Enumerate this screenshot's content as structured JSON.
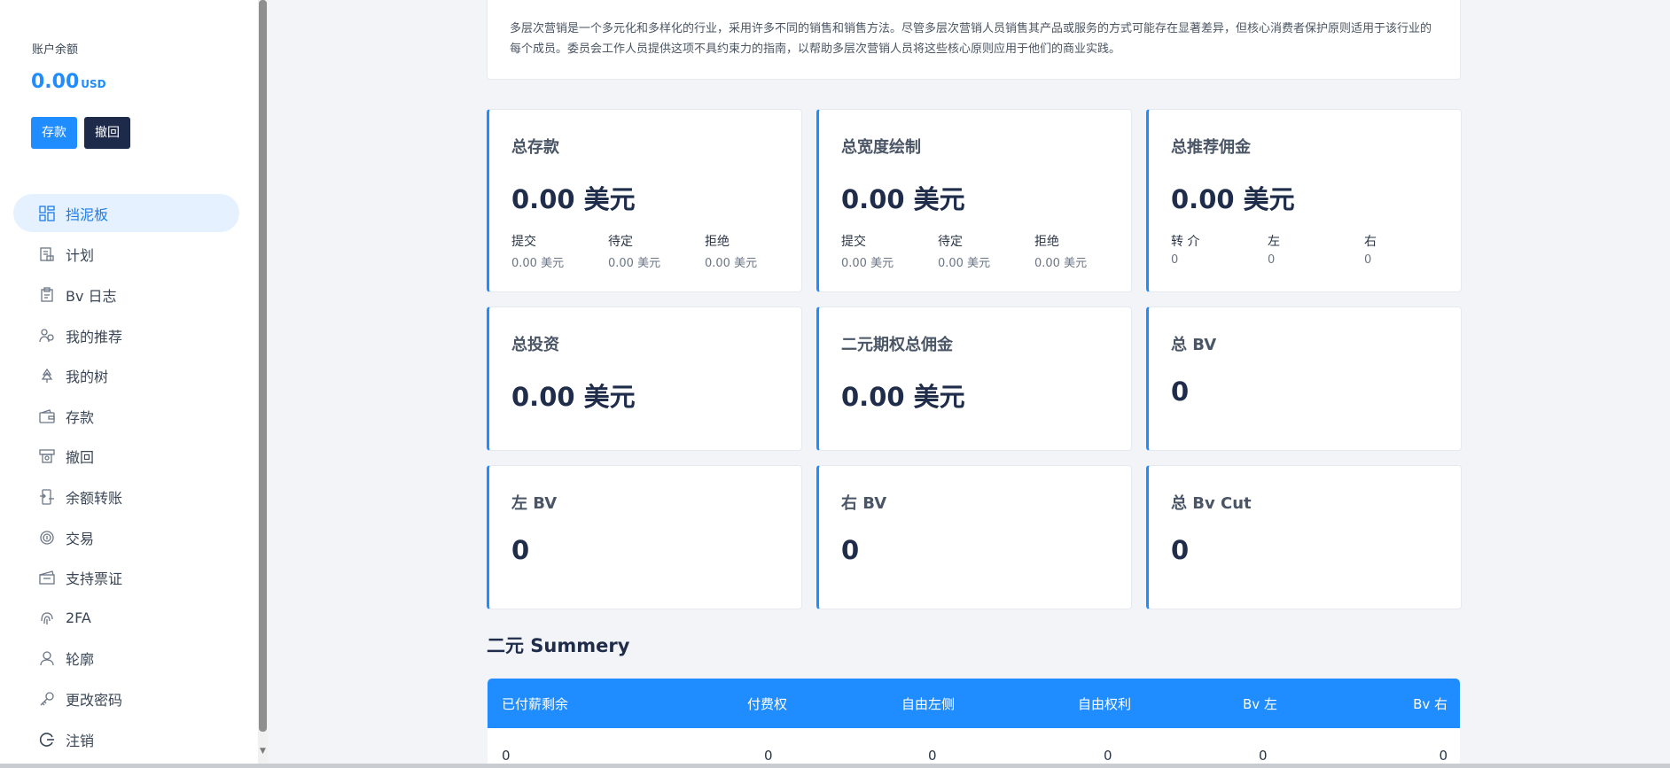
{
  "sidebar": {
    "balance_label": "账户余额",
    "balance_value": "0.00",
    "balance_currency": "USD",
    "deposit_button": "存款",
    "withdraw_button": "撤回",
    "items": [
      {
        "label": "挡泥板",
        "icon": "dashboard-icon",
        "active": true
      },
      {
        "label": "计划",
        "icon": "plan-icon"
      },
      {
        "label": "Bv 日志",
        "icon": "log-icon"
      },
      {
        "label": "我的推荐",
        "icon": "referral-icon"
      },
      {
        "label": "我的树",
        "icon": "tree-icon"
      },
      {
        "label": "存款",
        "icon": "wallet-icon"
      },
      {
        "label": "撤回",
        "icon": "withdraw-icon"
      },
      {
        "label": "余额转账",
        "icon": "transfer-icon"
      },
      {
        "label": "交易",
        "icon": "transaction-icon"
      },
      {
        "label": "支持票证",
        "icon": "ticket-icon"
      },
      {
        "label": "2FA",
        "icon": "fingerprint-icon"
      },
      {
        "label": "轮廓",
        "icon": "user-icon"
      },
      {
        "label": "更改密码",
        "icon": "key-icon"
      },
      {
        "label": "注销",
        "icon": "logout-icon"
      }
    ]
  },
  "intro": {
    "text": "多层次营销是一个多元化和多样化的行业，采用许多不同的销售和销售方法。尽管多层次营销人员销售其产品或服务的方式可能存在显著差异，但核心消费者保护原则适用于该行业的每个成员。委员会工作人员提供这项不具约束力的指南，以帮助多层次营销人员将这些核心原则应用于他们的商业实践。"
  },
  "cards": {
    "total_deposit": {
      "title": "总存款",
      "value": "0.00 美元",
      "subs": [
        {
          "label": "提交",
          "value": "0.00 美元"
        },
        {
          "label": "待定",
          "value": "0.00 美元"
        },
        {
          "label": "拒绝",
          "value": "0.00 美元"
        }
      ]
    },
    "total_withdraw": {
      "title": "总宽度绘制",
      "value": "0.00 美元",
      "subs": [
        {
          "label": "提交",
          "value": "0.00 美元"
        },
        {
          "label": "待定",
          "value": "0.00 美元"
        },
        {
          "label": "拒绝",
          "value": "0.00 美元"
        }
      ]
    },
    "total_referral": {
      "title": "总推荐佣金",
      "value": "0.00 美元",
      "subs": [
        {
          "label": "转 介",
          "value": "0"
        },
        {
          "label": "左",
          "value": "0"
        },
        {
          "label": "右",
          "value": "0"
        }
      ]
    },
    "total_invest": {
      "title": "总投资",
      "value": "0.00 美元"
    },
    "binary_commission": {
      "title": "二元期权总佣金",
      "value": "0.00 美元"
    },
    "total_bv": {
      "title": "总 BV",
      "value": "0"
    },
    "left_bv": {
      "title": "左 BV",
      "value": "0"
    },
    "right_bv": {
      "title": "右 BV",
      "value": "0"
    },
    "total_bv_cut": {
      "title": "总 Bv Cut",
      "value": "0"
    }
  },
  "summary": {
    "title": "二元 Summery",
    "headers": [
      "已付薪剩余",
      "付费权",
      "自由左侧",
      "自由权利",
      "Bv 左",
      "Bv 右"
    ],
    "row": [
      "0",
      "0",
      "0",
      "0",
      "0",
      "0"
    ]
  },
  "colors": {
    "accent": "#1f8cff",
    "dark": "#1e2a4a",
    "active_bg": "#e6f1ff"
  }
}
